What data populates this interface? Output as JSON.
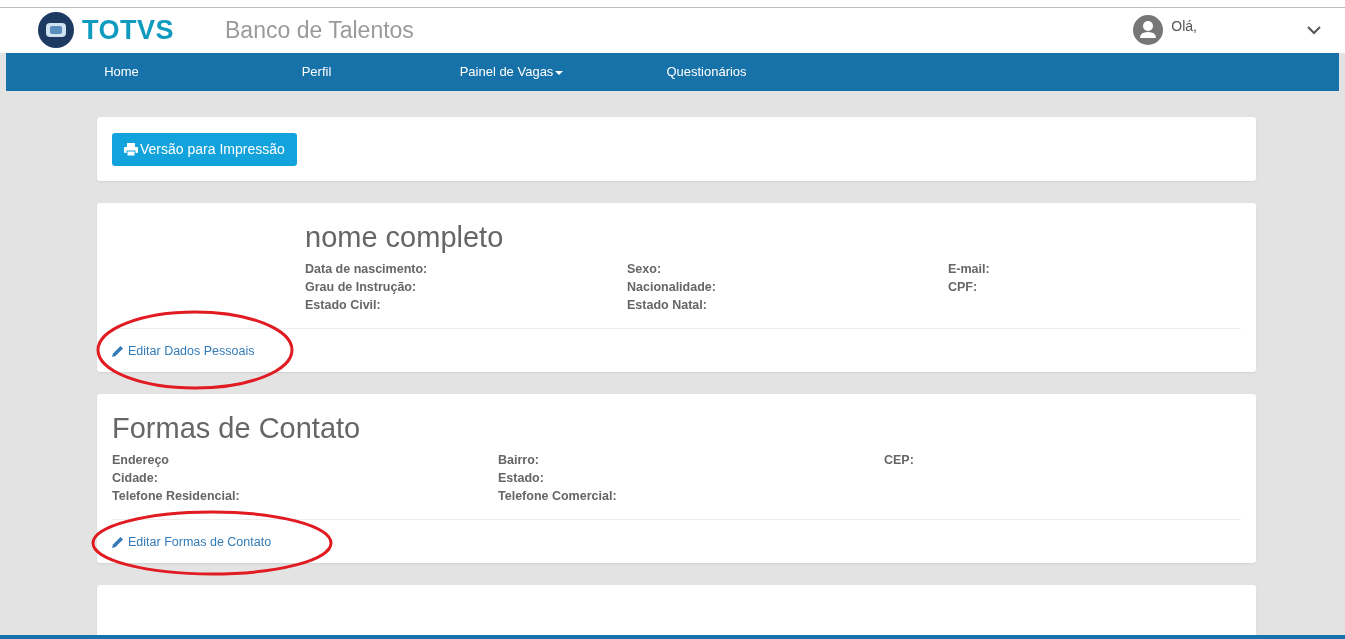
{
  "header": {
    "logo_text": "TOTVS",
    "app_title": "Banco de Talentos",
    "greeting": "Olá,"
  },
  "nav": [
    {
      "label": "Home",
      "dropdown": false
    },
    {
      "label": "Perfil",
      "dropdown": false
    },
    {
      "label": "Painel de Vagas",
      "dropdown": true
    },
    {
      "label": "Questionários",
      "dropdown": false
    }
  ],
  "print_button": "Versão para Impressão",
  "personal": {
    "title": "nome completo",
    "columns": [
      [
        "Data de nascimento:",
        "Grau de Instrução:",
        "Estado Civil:"
      ],
      [
        "Sexo:",
        "Nacionalidade:",
        "Estado Natal:"
      ],
      [
        "E-mail:",
        "CPF:"
      ]
    ],
    "edit_link": "Editar Dados Pessoais",
    "circled": true
  },
  "contact": {
    "title": "Formas de Contato",
    "columns": [
      [
        "Endereço",
        "Cidade:",
        "Telefone Residencial:"
      ],
      [
        "Bairro:",
        "Estado:",
        "Telefone Comercial:"
      ],
      [
        "CEP:"
      ]
    ],
    "edit_link": "Editar Formas de Contato",
    "circled": true
  }
}
